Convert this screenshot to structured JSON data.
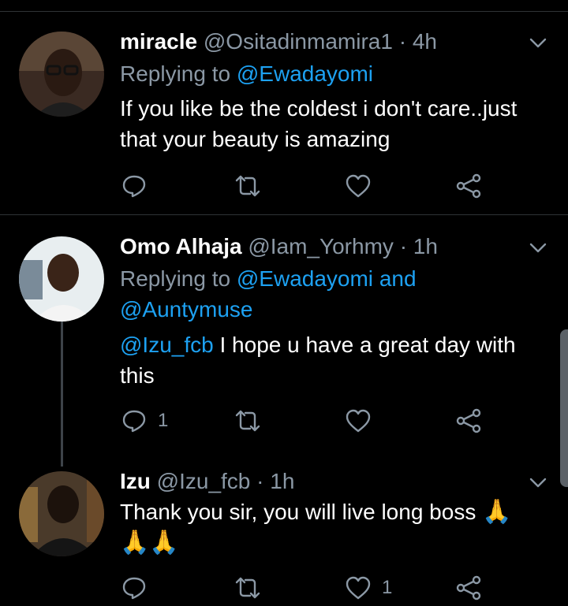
{
  "colors": {
    "background": "#000000",
    "link": "#1da1f2",
    "muted": "#8b98a5",
    "divider": "#2f3336",
    "emoji": "#f5b21a"
  },
  "tweets": [
    {
      "name": "miracle",
      "handle": "@Ositadinmamira1",
      "dot": "·",
      "time": "4h",
      "reply_prefix": "Replying to",
      "reply_users": [
        "@Ewadayomi"
      ],
      "text": "If you like be the coldest i don't care..just that your beauty is amazing",
      "reply_count": "",
      "retweet_count": "",
      "like_count": ""
    },
    {
      "name": "Omo Alhaja",
      "handle": "@Iam_Yorhmy",
      "dot": "·",
      "time": "1h",
      "reply_prefix": "Replying to",
      "reply_users": [
        "@Ewadayomi",
        "@Auntymuse"
      ],
      "reply_joiner": "and",
      "mention": "@Izu_fcb",
      "text": "I hope u have a great day with this",
      "reply_count": "1",
      "retweet_count": "",
      "like_count": ""
    },
    {
      "name": "Izu",
      "handle": "@Izu_fcb",
      "dot": "·",
      "time": "1h",
      "text": "Thank you sir, you will live long boss",
      "emoji": "🙏",
      "emoji_line": "🙏🙏",
      "reply_count": "",
      "retweet_count": "",
      "like_count": "1"
    }
  ],
  "icons": {
    "reply": "reply-icon",
    "retweet": "retweet-icon",
    "like": "heart-icon",
    "share": "share-icon",
    "menu": "chevron-down-icon"
  }
}
